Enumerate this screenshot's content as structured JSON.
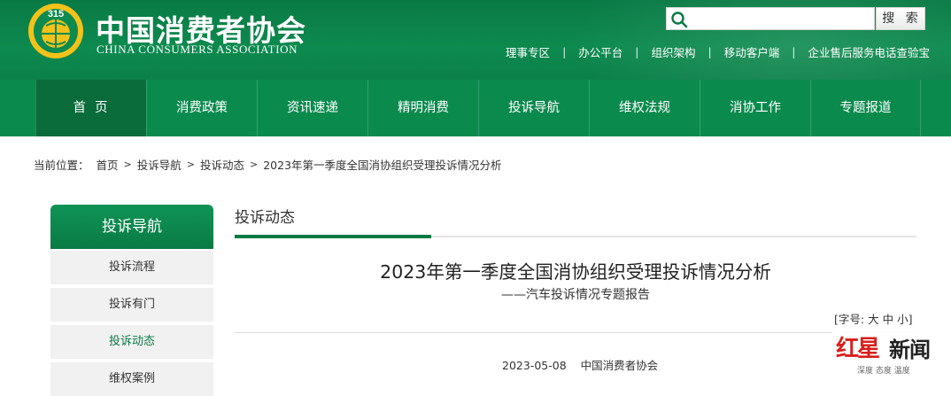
{
  "header": {
    "brand_cn": "中国消费者协会",
    "brand_en": "CHINA CONSUMERS ASSOCIATION",
    "logo_text": "315",
    "search_placeholder": "",
    "search_button": "搜 索",
    "top_links": [
      "理事专区",
      "办公平台",
      "组织架构",
      "移动客户端",
      "企业售后服务电话查验宝"
    ]
  },
  "nav": {
    "items": [
      "首页",
      "消费政策",
      "资讯速递",
      "精明消费",
      "投诉导航",
      "维权法规",
      "消协工作",
      "专题报道"
    ],
    "active_index": 0
  },
  "breadcrumb": {
    "prefix": "当前位置：",
    "items": [
      "首页",
      "投诉导航",
      "投诉动态",
      "2023年第一季度全国消协组织受理投诉情况分析"
    ]
  },
  "sidebar": {
    "title": "投诉导航",
    "items": [
      "投诉流程",
      "投诉有门",
      "投诉动态",
      "维权案例"
    ],
    "active_index": 2
  },
  "content": {
    "section_title": "投诉动态",
    "title": "2023年第一季度全国消协组织受理投诉情况分析",
    "subtitle": "——汽车投诉情况专题报告",
    "fontsize_label": "[字号:",
    "fontsize_options": [
      "大",
      "中",
      "小"
    ],
    "fontsize_end": "]",
    "date": "2023-05-08",
    "source": "中国消费者协会"
  },
  "watermark": {
    "red": "红星",
    "black": "新闻",
    "tag": "深度 态度 温度"
  },
  "colors": {
    "header_green": "#0d8a4f",
    "nav_active": "#0a6b3b",
    "accent": "#0a7a45"
  }
}
